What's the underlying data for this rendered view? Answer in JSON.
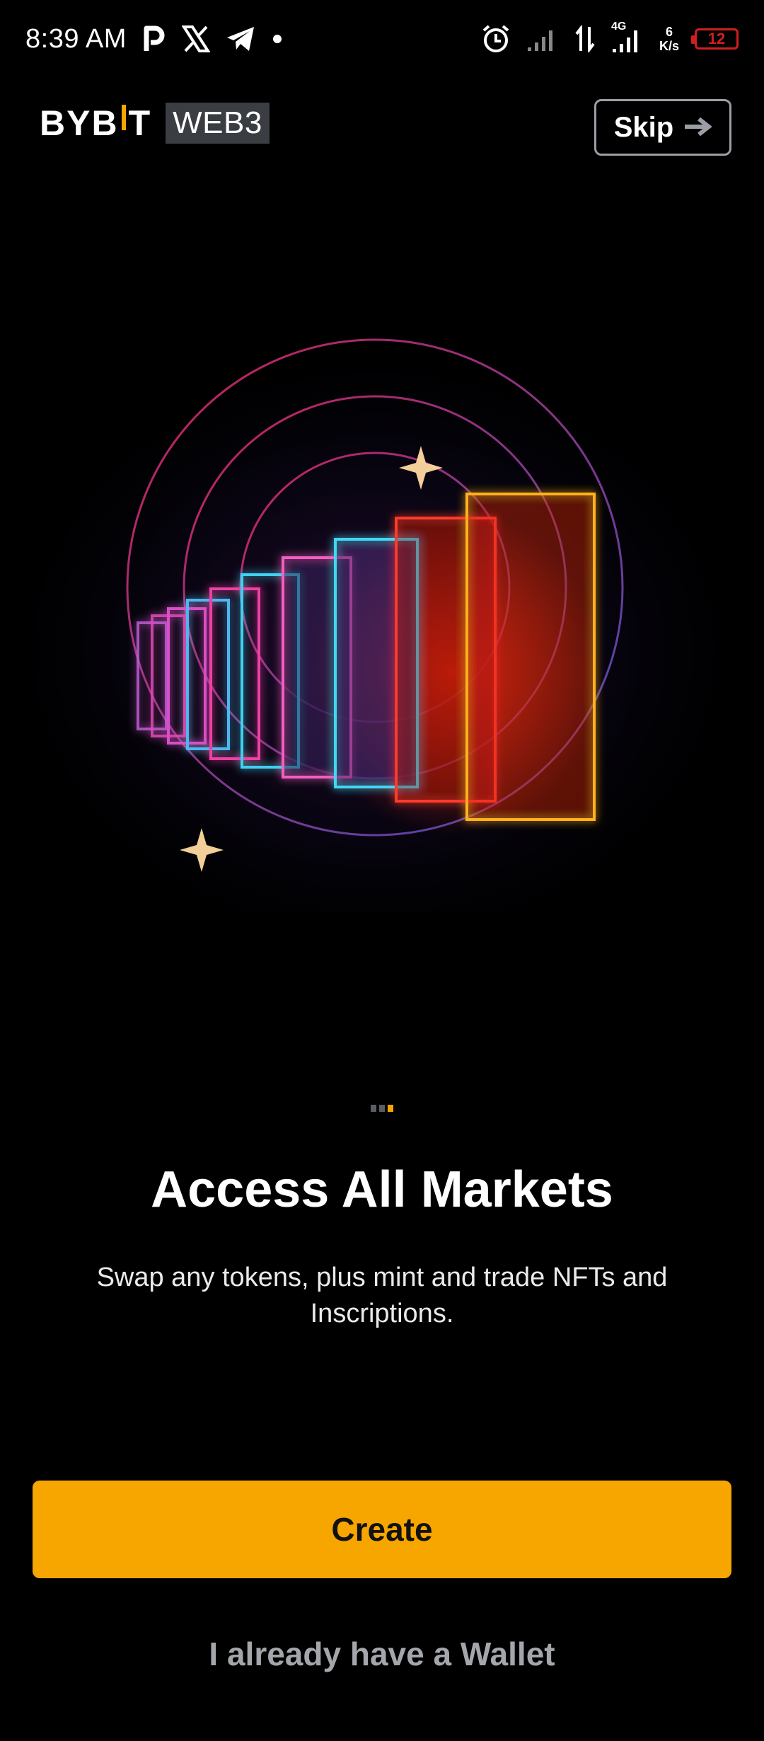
{
  "status_bar": {
    "time": "8:39 AM",
    "network_type": "4G",
    "net_speed_value": "6",
    "net_speed_unit": "K/s",
    "battery_level": "12",
    "icons": [
      "parking-app-icon",
      "x-icon",
      "telegram-icon",
      "dot-icon",
      "alarm-icon",
      "signal-icon",
      "data-arrows-icon",
      "signal-4g-icon",
      "battery-icon"
    ]
  },
  "header": {
    "logo_left": "BYB",
    "logo_right": "T",
    "logo_badge": "WEB3",
    "skip_label": "Skip"
  },
  "pager": {
    "total": 3,
    "active_index": 2
  },
  "onboarding": {
    "title": "Access All Markets",
    "subtitle": "Swap any tokens, plus mint and trade NFTs and Inscriptions."
  },
  "actions": {
    "create_label": "Create",
    "existing_wallet_label": "I already have a Wallet"
  },
  "colors": {
    "accent": "#f7a600",
    "background": "#000000",
    "badge_bg": "#3a3d42",
    "battery_low": "#d01f1f"
  }
}
